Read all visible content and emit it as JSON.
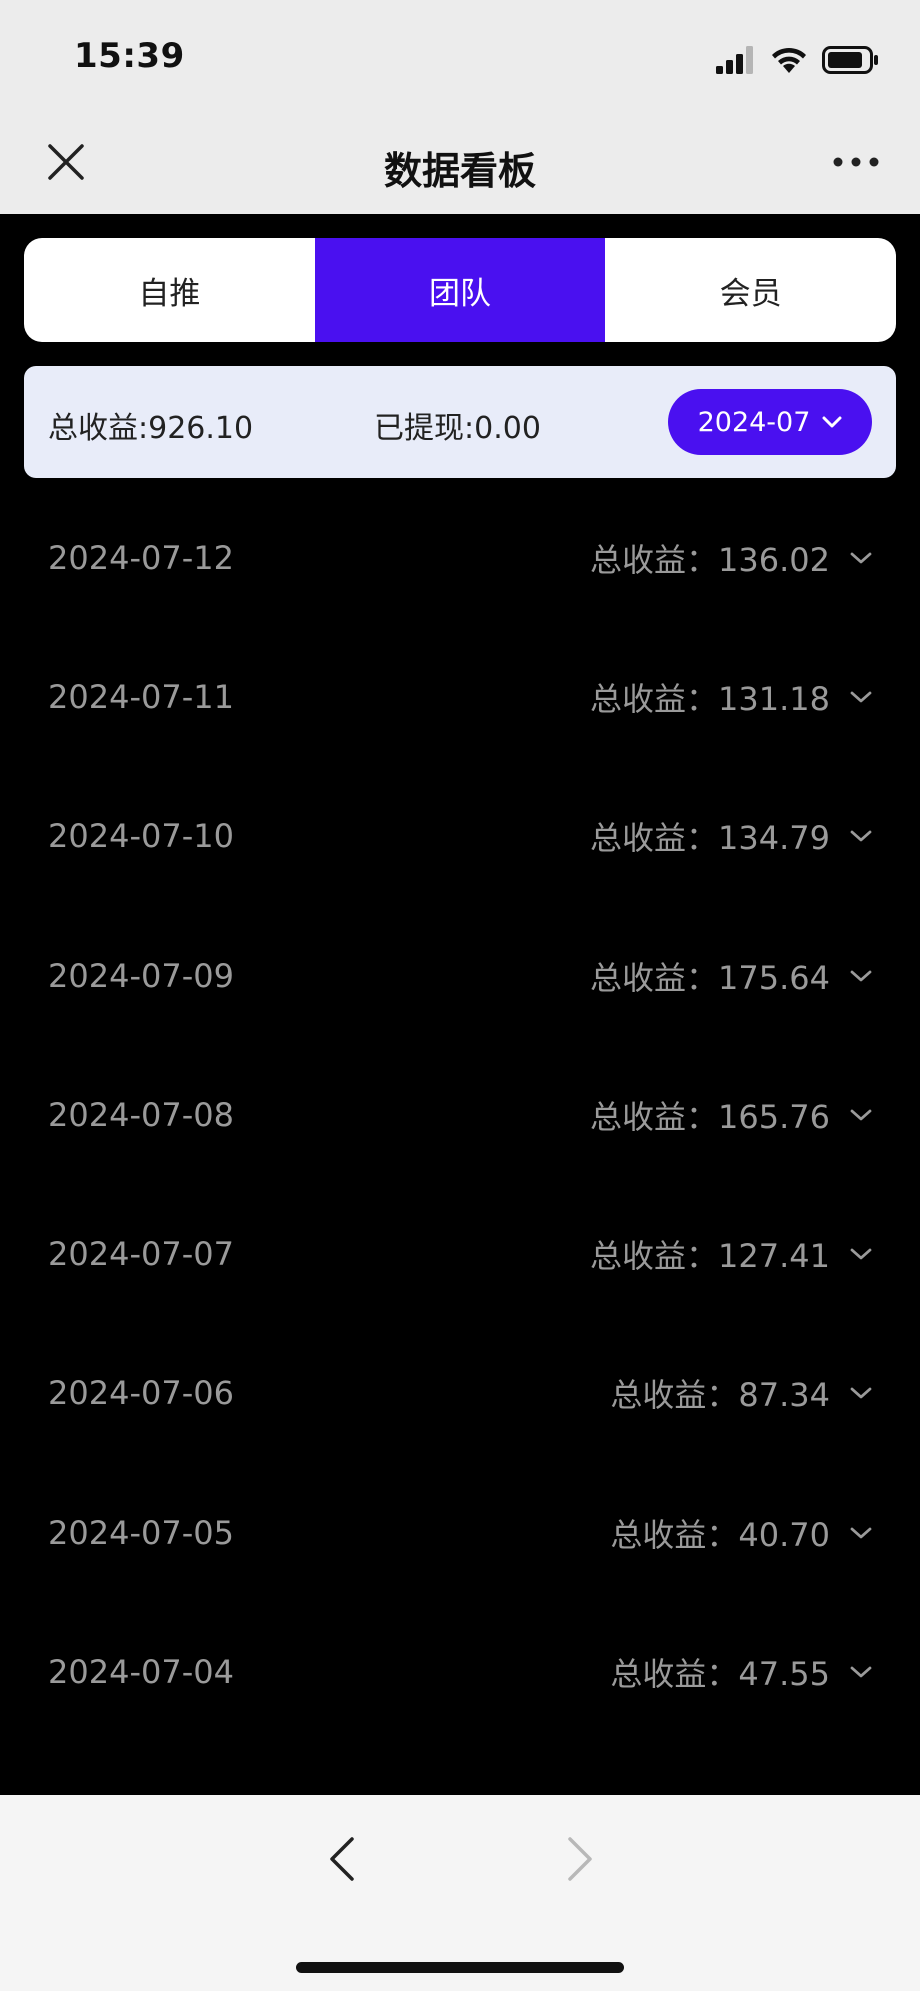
{
  "status_bar": {
    "time": "15:39"
  },
  "nav": {
    "title": "数据看板"
  },
  "tabs": [
    {
      "label": "自推",
      "active": false
    },
    {
      "label": "团队",
      "active": true
    },
    {
      "label": "会员",
      "active": false
    }
  ],
  "summary": {
    "total_income": "总收益:926.10",
    "withdrawn": "已提现:0.00",
    "month": "2024-07"
  },
  "list": [
    {
      "date": "2024-07-12",
      "income": "总收益：136.02"
    },
    {
      "date": "2024-07-11",
      "income": "总收益：131.18"
    },
    {
      "date": "2024-07-10",
      "income": "总收益：134.79"
    },
    {
      "date": "2024-07-09",
      "income": "总收益：175.64"
    },
    {
      "date": "2024-07-08",
      "income": "总收益：165.76"
    },
    {
      "date": "2024-07-07",
      "income": "总收益：127.41"
    },
    {
      "date": "2024-07-06",
      "income": "总收益：87.34"
    },
    {
      "date": "2024-07-05",
      "income": "总收益：40.70"
    },
    {
      "date": "2024-07-04",
      "income": "总收益：47.55"
    }
  ],
  "colors": {
    "accent": "#4a10f0",
    "summary_bg": "#e8ecf9",
    "list_text": "#9a9a9a",
    "page_bg": "#000000"
  },
  "icons": {
    "close": "close-icon",
    "more": "more-icon",
    "month_dropdown": "chevron-down-icon",
    "row_expand": "chevron-down-icon",
    "back": "chevron-left-icon",
    "forward": "chevron-right-icon"
  }
}
